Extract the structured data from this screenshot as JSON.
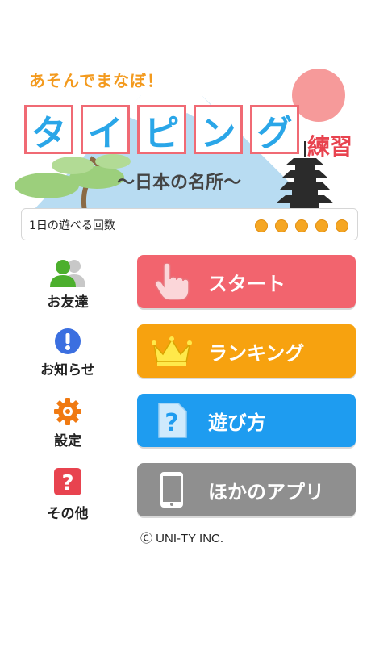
{
  "header": {
    "tagline": "あそんでまなぼ！",
    "title_chars": [
      "タ",
      "イ",
      "ピ",
      "ン",
      "グ"
    ],
    "title_suffix": "練習",
    "subtitle": "〜日本の名所〜"
  },
  "play_counter": {
    "label": "1日の遊べる回数",
    "remaining": 5,
    "max": 5
  },
  "side_menu": {
    "friends": "お友達",
    "news": "お知らせ",
    "settings": "設定",
    "other": "その他"
  },
  "buttons": {
    "start": "スタート",
    "ranking": "ランキング",
    "howto": "遊び方",
    "other_apps": "ほかのアプリ"
  },
  "footer": {
    "copyright": "Ⓒ UNI-TY INC."
  },
  "colors": {
    "start": "#f2646e",
    "ranking": "#f7a20f",
    "howto": "#1e9cf0",
    "other_apps": "#8f8f8f",
    "tile_border": "#f06a74",
    "tile_text": "#2aa6e8"
  }
}
